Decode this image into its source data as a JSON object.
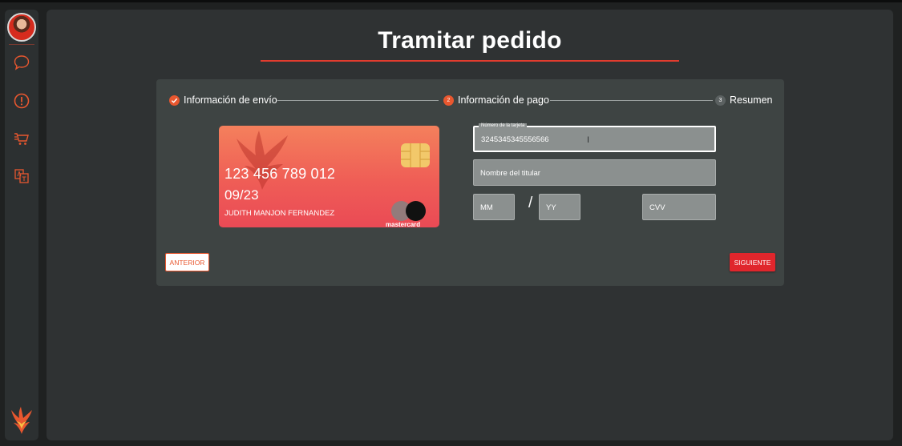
{
  "page": {
    "title": "Tramitar pedido"
  },
  "colors": {
    "accent": "#e8572f",
    "primary_button": "#e0262c",
    "panel": "#3e4443",
    "background": "#1f2121"
  },
  "sidebar": {
    "avatar": "user-avatar",
    "items": [
      {
        "icon": "chat-bubble-icon"
      },
      {
        "icon": "alert-circle-icon"
      },
      {
        "icon": "shopping-cart-icon"
      },
      {
        "icon": "translate-icon"
      }
    ],
    "logo": "phoenix-logo"
  },
  "stepper": {
    "steps": [
      {
        "label": "Información de envío",
        "state": "done",
        "marker": "check-icon"
      },
      {
        "label": "Información de pago",
        "state": "active",
        "number": "2"
      },
      {
        "label": "Resumen",
        "state": "pending",
        "number": "3"
      }
    ]
  },
  "card": {
    "number": "123 456 789 012",
    "expiry": "09/23",
    "holder": "JUDITH MANJON FERNANDEZ",
    "brand": "mastercard"
  },
  "form": {
    "card_number_label": "Número de la tarjeta",
    "card_number_value": "3245345345556566",
    "holder_placeholder": "Nombre del titular",
    "month_placeholder": "MM",
    "year_placeholder": "YY",
    "cvv_placeholder": "CVV",
    "separator": "/"
  },
  "buttons": {
    "previous": "ANTERIOR",
    "next": "SIGUIENTE"
  }
}
